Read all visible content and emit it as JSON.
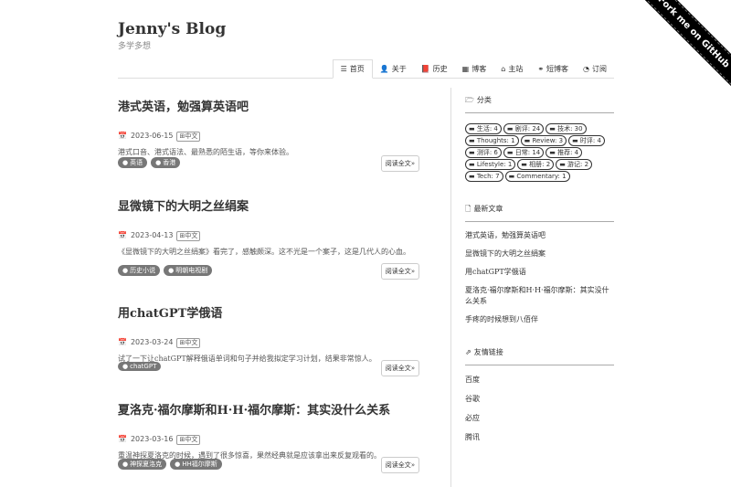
{
  "ribbon": "Fork me on GitHub",
  "site": {
    "title": "Jenny's Blog",
    "description": "多学多想"
  },
  "nav": [
    {
      "icon": "list-icon",
      "glyph": "☰",
      "label": "首页"
    },
    {
      "icon": "user-icon",
      "glyph": "👤",
      "label": "关于"
    },
    {
      "icon": "book-icon",
      "glyph": "📕",
      "label": "历史"
    },
    {
      "icon": "blog-icon",
      "glyph": "▦",
      "label": "博客"
    },
    {
      "icon": "home-icon",
      "glyph": "⌂",
      "label": "主站"
    },
    {
      "icon": "link-icon",
      "glyph": "⚭",
      "label": "短博客"
    },
    {
      "icon": "rss-icon",
      "glyph": "◔",
      "label": "订阅"
    }
  ],
  "posts": [
    {
      "title": "港式英语，勉强算英语吧",
      "date": "2023-06-15",
      "lang": "中文",
      "excerpt": "港式口音、港式语法、最熟悉的陌生语，等你来体验。",
      "tags": [
        "英语",
        "香港"
      ],
      "read_more": "阅读全文»"
    },
    {
      "title": "显微镜下的大明之丝绢案",
      "date": "2023-04-13",
      "lang": "中文",
      "excerpt": "《显微镜下的大明之丝绢案》看完了，感触颇深。这不光是一个案子，这是几代人的心血。",
      "tags": [
        "历史小说",
        "明朝电视剧"
      ],
      "read_more": "阅读全文»"
    },
    {
      "title": "用chatGPT学俄语",
      "date": "2023-03-24",
      "lang": "中文",
      "excerpt": "试了一下让chatGPT解释俄语单词和句子并给我拟定学习计划，结果非常惊人。",
      "tags": [
        "chatGPT"
      ],
      "read_more": "阅读全文»"
    },
    {
      "title": "夏洛克·福尔摩斯和H·H·福尔摩斯：其实没什么关系",
      "date": "2023-03-16",
      "lang": "中文",
      "excerpt": "重温神探夏洛克的时候，遇到了很多惊喜，果然经典就是应该拿出来反复观看的。",
      "tags": [
        "神探夏洛克",
        "HH福尔摩斯"
      ],
      "read_more": "阅读全文»"
    }
  ],
  "sidebar": {
    "categories_title": "分类",
    "categories": [
      "生活: 4",
      "剧评: 24",
      "技术: 30",
      "Thoughts: 1",
      "Review: 3",
      "时评: 4",
      "测评: 6",
      "日常: 14",
      "推荐: 4",
      "Lifestyle: 1",
      "相册: 2",
      "游记: 2",
      "Tech: 7",
      "Commentary: 1"
    ],
    "recent_title": "最新文章",
    "recent": [
      "港式英语，勉强算英语吧",
      "显微镜下的大明之丝绢案",
      "用chatGPT学俄语",
      "夏洛克·福尔摩斯和H·H·福尔摩斯：其实没什么关系",
      "手疼的时候想到八佰伴"
    ],
    "links_title": "友情链接",
    "links": [
      "百度",
      "谷歌",
      "必应",
      "腾讯"
    ]
  }
}
